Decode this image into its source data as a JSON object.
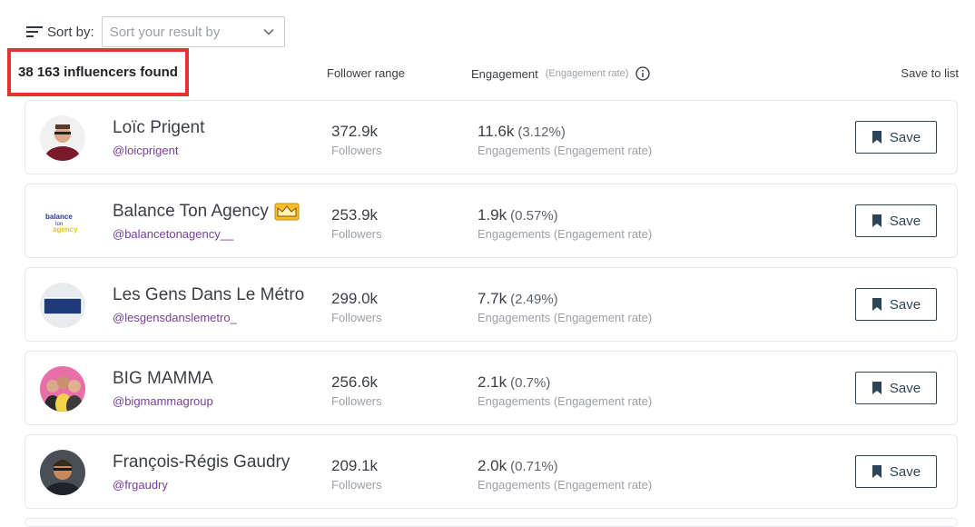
{
  "sort": {
    "label": "Sort by:",
    "placeholder": "Sort your result by"
  },
  "results": {
    "count_text": "38 163 influencers found"
  },
  "columns": {
    "follower": "Follower range",
    "engagement": "Engagement",
    "engagement_sub": "(Engagement rate)",
    "save": "Save to list"
  },
  "influencers": [
    {
      "name": "Loïc Prigent",
      "handle": "@loicprigent",
      "followers": "372.9k",
      "followers_label": "Followers",
      "engagement": "11.6k",
      "rate": "(3.12%)",
      "engagement_label": "Engagements (Engagement rate)",
      "save_label": "Save",
      "avatar_icon": "person-photo"
    },
    {
      "name": "Balance Ton Agency",
      "handle": "@balancetonagency__",
      "followers": "253.9k",
      "followers_label": "Followers",
      "engagement": "1.9k",
      "rate": "(0.57%)",
      "engagement_label": "Engagements (Engagement rate)",
      "save_label": "Save",
      "avatar_icon": "balance-ton-agency-logo",
      "badge_icon": "crown-icon"
    },
    {
      "name": "Les Gens Dans Le Métro",
      "handle": "@lesgensdanslemetro_",
      "followers": "299.0k",
      "followers_label": "Followers",
      "engagement": "7.7k",
      "rate": "(2.49%)",
      "engagement_label": "Engagements (Engagement rate)",
      "save_label": "Save",
      "avatar_icon": "metro-sign-logo"
    },
    {
      "name": "BIG MAMMA",
      "handle": "@bigmammagroup",
      "followers": "256.6k",
      "followers_label": "Followers",
      "engagement": "2.1k",
      "rate": "(0.7%)",
      "engagement_label": "Engagements (Engagement rate)",
      "save_label": "Save",
      "avatar_icon": "group-photo"
    },
    {
      "name": "François-Régis Gaudry",
      "handle": "@frgaudry",
      "followers": "209.1k",
      "followers_label": "Followers",
      "engagement": "2.0k",
      "rate": "(0.71%)",
      "engagement_label": "Engagements (Engagement rate)",
      "save_label": "Save",
      "avatar_icon": "person-photo"
    }
  ],
  "colors": {
    "highlight": "#e8322f",
    "handle": "#7a3e9d",
    "button": "#2d4556"
  }
}
